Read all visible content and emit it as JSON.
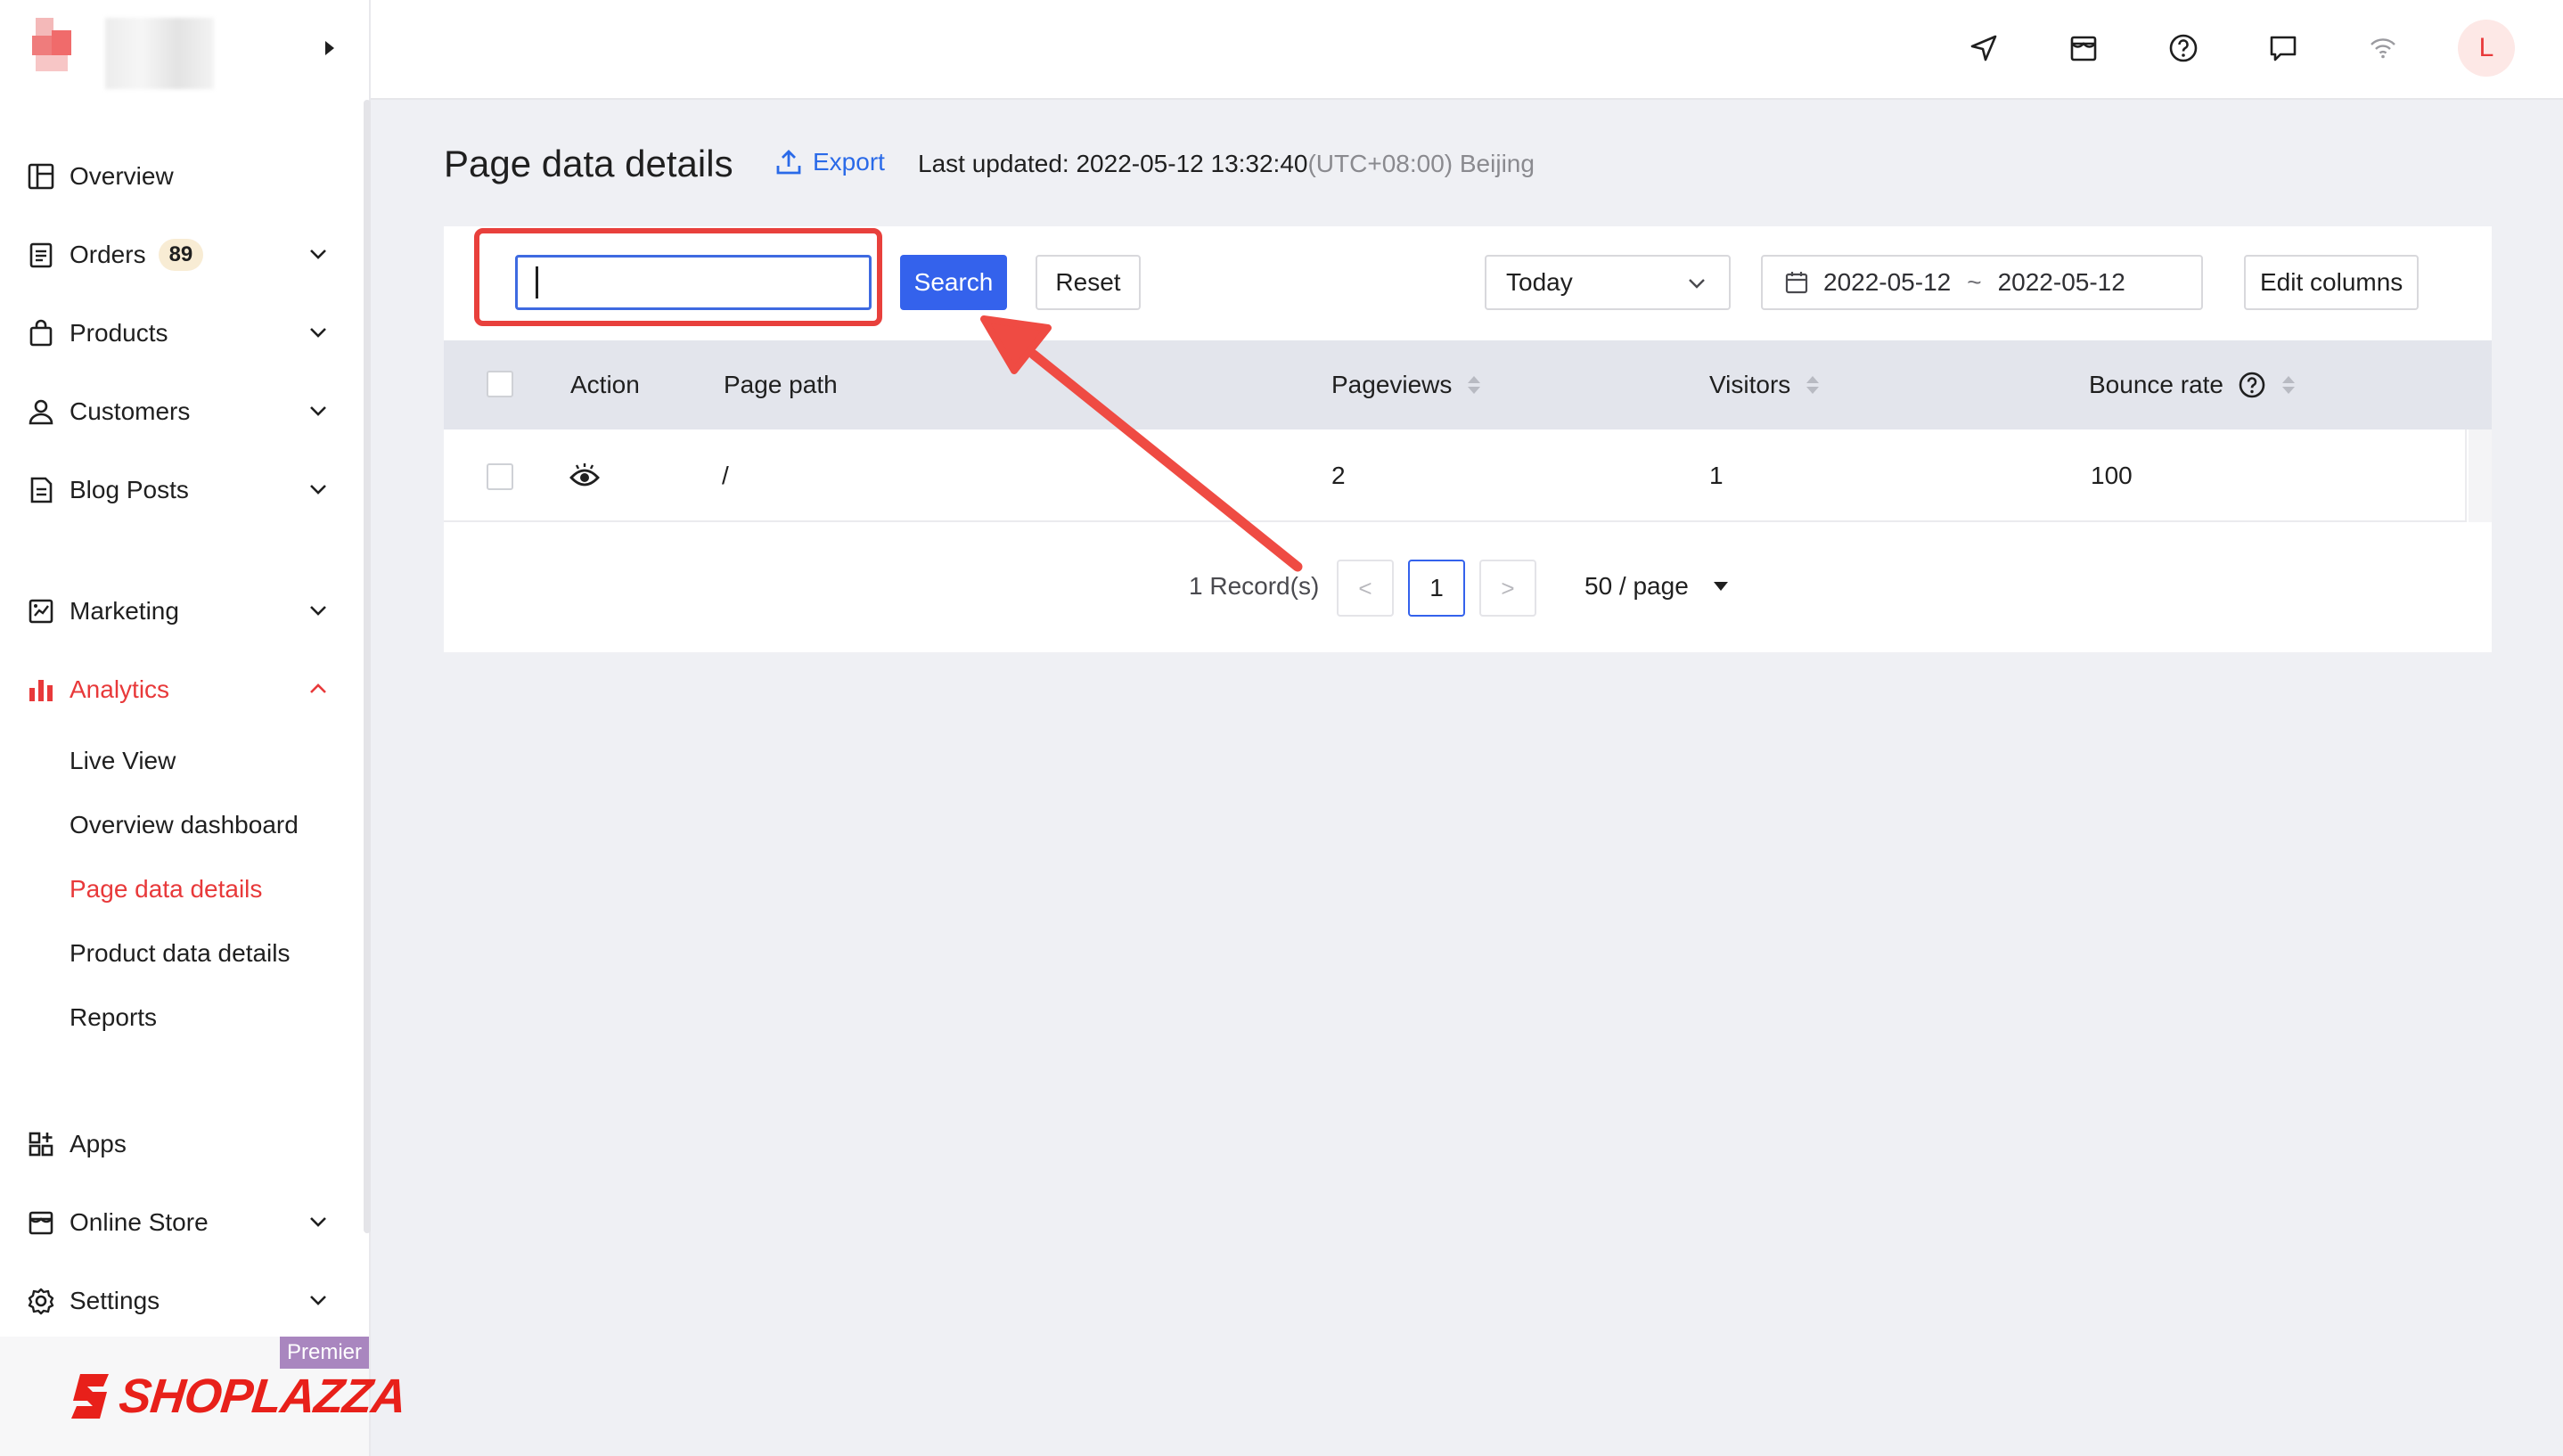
{
  "colors": {
    "accent_red": "#e8393a",
    "primary_blue": "#3462ec",
    "link_blue": "#2a6ae8",
    "badge_bg": "#f8ecd4",
    "premier_bg": "#a986bf"
  },
  "sidebar": {
    "items": [
      {
        "label": "Overview",
        "icon": "overview-layout-icon"
      },
      {
        "label": "Orders",
        "icon": "clipboard-icon",
        "badge": "89"
      },
      {
        "label": "Products",
        "icon": "shopping-bag-icon"
      },
      {
        "label": "Customers",
        "icon": "person-icon"
      },
      {
        "label": "Blog Posts",
        "icon": "document-icon"
      },
      {
        "label": "Marketing",
        "icon": "marketing-icon"
      },
      {
        "label": "Analytics",
        "icon": "bar-chart-icon",
        "active": true
      },
      {
        "label": "Apps",
        "icon": "apps-grid-icon"
      },
      {
        "label": "Online Store",
        "icon": "storefront-icon"
      },
      {
        "label": "Settings",
        "icon": "gear-icon"
      }
    ],
    "analytics_sub": [
      {
        "label": "Live View"
      },
      {
        "label": "Overview dashboard"
      },
      {
        "label": "Page data details",
        "active": true
      },
      {
        "label": "Product data details"
      },
      {
        "label": "Reports"
      }
    ],
    "brand": {
      "name": "SHOPLAZZA",
      "plan": "Premier"
    }
  },
  "topbar": {
    "icons": [
      "navigation-arrow-icon",
      "store-icon",
      "help-circle-icon",
      "chat-icon",
      "wifi-icon"
    ],
    "avatar_initial": "L"
  },
  "header": {
    "title": "Page data details",
    "export_label": "Export",
    "last_updated_prefix": "Last updated: ",
    "last_updated_value": "2022-05-12 13:32:40",
    "timezone": "(UTC+08:00) Beijing"
  },
  "filters": {
    "search_value": "",
    "search_label": "Search",
    "reset_label": "Reset",
    "range_selected": "Today",
    "date_start": "2022-05-12",
    "date_sep": "~",
    "date_end": "2022-05-12",
    "edit_columns_label": "Edit columns"
  },
  "table": {
    "columns": [
      "Action",
      "Page path",
      "Pageviews",
      "Visitors",
      "Bounce rate"
    ],
    "rows": [
      {
        "action_icon": "eye-icon",
        "page_path": "/",
        "pageviews": "2",
        "visitors": "1",
        "bounce_rate": "100"
      }
    ]
  },
  "pagination": {
    "records": "1 Record(s)",
    "prev": "<",
    "current": "1",
    "next": ">",
    "page_size": "50 / page"
  }
}
